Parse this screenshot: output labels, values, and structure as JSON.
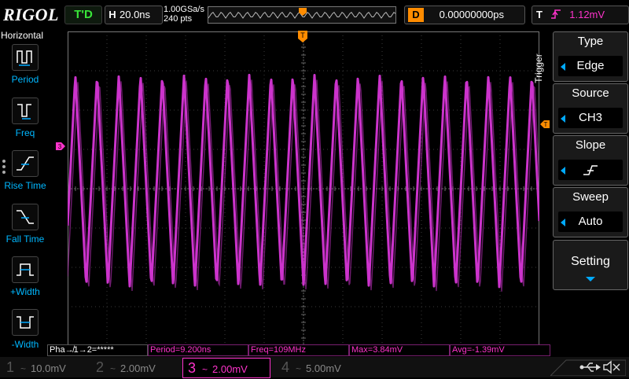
{
  "brand": "RIGOL",
  "status": "T'D",
  "horizontal": {
    "key": "H",
    "timebase": "20.0ns",
    "sample_rate": "1.00GSa/s",
    "points": "240 pts"
  },
  "delay": {
    "key": "D",
    "value": "0.00000000ps"
  },
  "trigger_status": {
    "key": "T",
    "level": "1.12mV"
  },
  "left_panel": {
    "title": "Horizontal",
    "items": [
      {
        "label": "Period",
        "icon": "period-icon"
      },
      {
        "label": "Freq",
        "icon": "freq-icon"
      },
      {
        "label": "Rise Time",
        "icon": "rise-time-icon"
      },
      {
        "label": "Fall Time",
        "icon": "fall-time-icon"
      },
      {
        "label": "+Width",
        "icon": "positive-width-icon"
      },
      {
        "label": "-Width",
        "icon": "negative-width-icon"
      }
    ]
  },
  "channel_marker": "3",
  "trigger_marker": "T",
  "right_menu": {
    "title": "Trigger",
    "items": [
      {
        "title": "Type",
        "value": "Edge"
      },
      {
        "title": "Source",
        "value": "CH3"
      },
      {
        "title": "Slope",
        "value": ""
      },
      {
        "title": "Sweep",
        "value": "Auto"
      }
    ],
    "setting": "Setting"
  },
  "measurements": {
    "phase": "Pha↛1→2=*****",
    "period": "Period=9.200ns",
    "freq": "Freq=109MHz",
    "max": "Max=3.84mV",
    "avg": "Avg=-1.39mV"
  },
  "channels": [
    {
      "num": "1",
      "coupling": "~",
      "scale": "10.0mV"
    },
    {
      "num": "2",
      "coupling": "~",
      "scale": "2.00mV"
    },
    {
      "num": "3",
      "coupling": "~",
      "scale": "2.00mV"
    },
    {
      "num": "4",
      "coupling": "~",
      "scale": "5.00mV"
    }
  ],
  "waveform": {
    "color": "#cc33cc",
    "cycles_on_screen": 21.7,
    "amplitude_divs": 2.7,
    "center_div_offset": 0.2
  },
  "colors": {
    "ch3": "#ff33cc",
    "accent": "#00aaff",
    "trigger": "#ff8c00",
    "status_ok": "#39e639"
  }
}
